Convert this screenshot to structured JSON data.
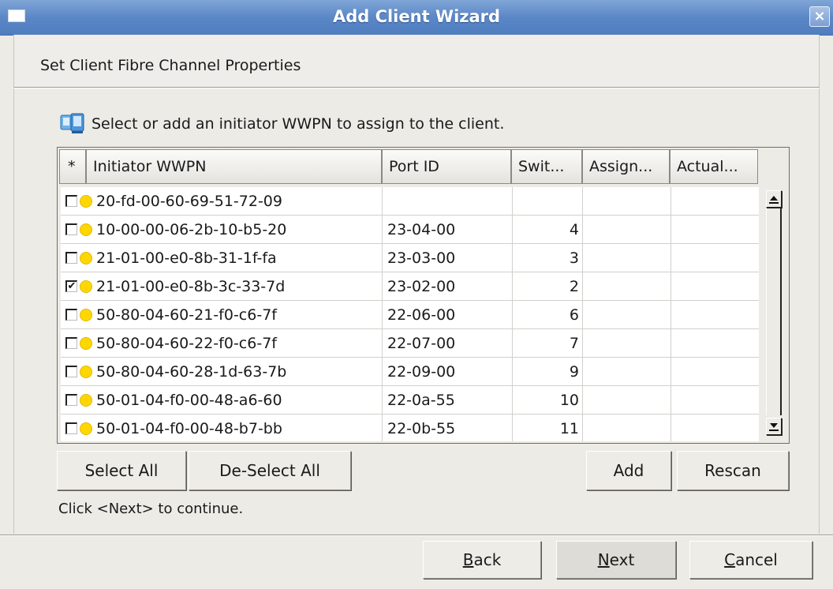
{
  "window": {
    "title": "Add Client Wizard",
    "close_glyph": "×"
  },
  "header": {
    "subtitle": "Set Client Fibre Channel Properties"
  },
  "instruction": {
    "text": "Select or add an initiator WWPN to assign to the client.",
    "icon": "network-computer-icon"
  },
  "table": {
    "columns": [
      "*",
      "Initiator WWPN",
      "Port ID",
      "Swit...",
      "Assign...",
      "Actual..."
    ],
    "rows": [
      {
        "checked": false,
        "wwpn": "20-fd-00-60-69-51-72-09",
        "port_id": "",
        "switch": "",
        "assigned": "",
        "actual": ""
      },
      {
        "checked": false,
        "wwpn": "10-00-00-06-2b-10-b5-20",
        "port_id": "23-04-00",
        "switch": "4",
        "assigned": "",
        "actual": ""
      },
      {
        "checked": false,
        "wwpn": "21-01-00-e0-8b-31-1f-fa",
        "port_id": "23-03-00",
        "switch": "3",
        "assigned": "",
        "actual": ""
      },
      {
        "checked": true,
        "wwpn": "21-01-00-e0-8b-3c-33-7d",
        "port_id": "23-02-00",
        "switch": "2",
        "assigned": "",
        "actual": ""
      },
      {
        "checked": false,
        "wwpn": "50-80-04-60-21-f0-c6-7f",
        "port_id": "22-06-00",
        "switch": "6",
        "assigned": "",
        "actual": ""
      },
      {
        "checked": false,
        "wwpn": "50-80-04-60-22-f0-c6-7f",
        "port_id": "22-07-00",
        "switch": "7",
        "assigned": "",
        "actual": ""
      },
      {
        "checked": false,
        "wwpn": "50-80-04-60-28-1d-63-7b",
        "port_id": "22-09-00",
        "switch": "9",
        "assigned": "",
        "actual": ""
      },
      {
        "checked": false,
        "wwpn": "50-01-04-f0-00-48-a6-60",
        "port_id": "22-0a-55",
        "switch": "10",
        "assigned": "",
        "actual": ""
      },
      {
        "checked": false,
        "wwpn": "50-01-04-f0-00-48-b7-bb",
        "port_id": "22-0b-55",
        "switch": "11",
        "assigned": "",
        "actual": ""
      }
    ],
    "status_color": "#ffd700"
  },
  "table_buttons": {
    "select_all": "Select All",
    "deselect_all": "De-Select All",
    "add": "Add",
    "rescan": "Rescan"
  },
  "hint": "Click <Next> to continue.",
  "footer": {
    "back": {
      "mnemonic": "B",
      "rest": "ack"
    },
    "next": {
      "mnemonic": "N",
      "rest": "ext"
    },
    "cancel": {
      "mnemonic": "C",
      "rest": "ancel"
    }
  },
  "colors": {
    "titlebar": "#5b87c6",
    "background": "#ecebe6"
  }
}
